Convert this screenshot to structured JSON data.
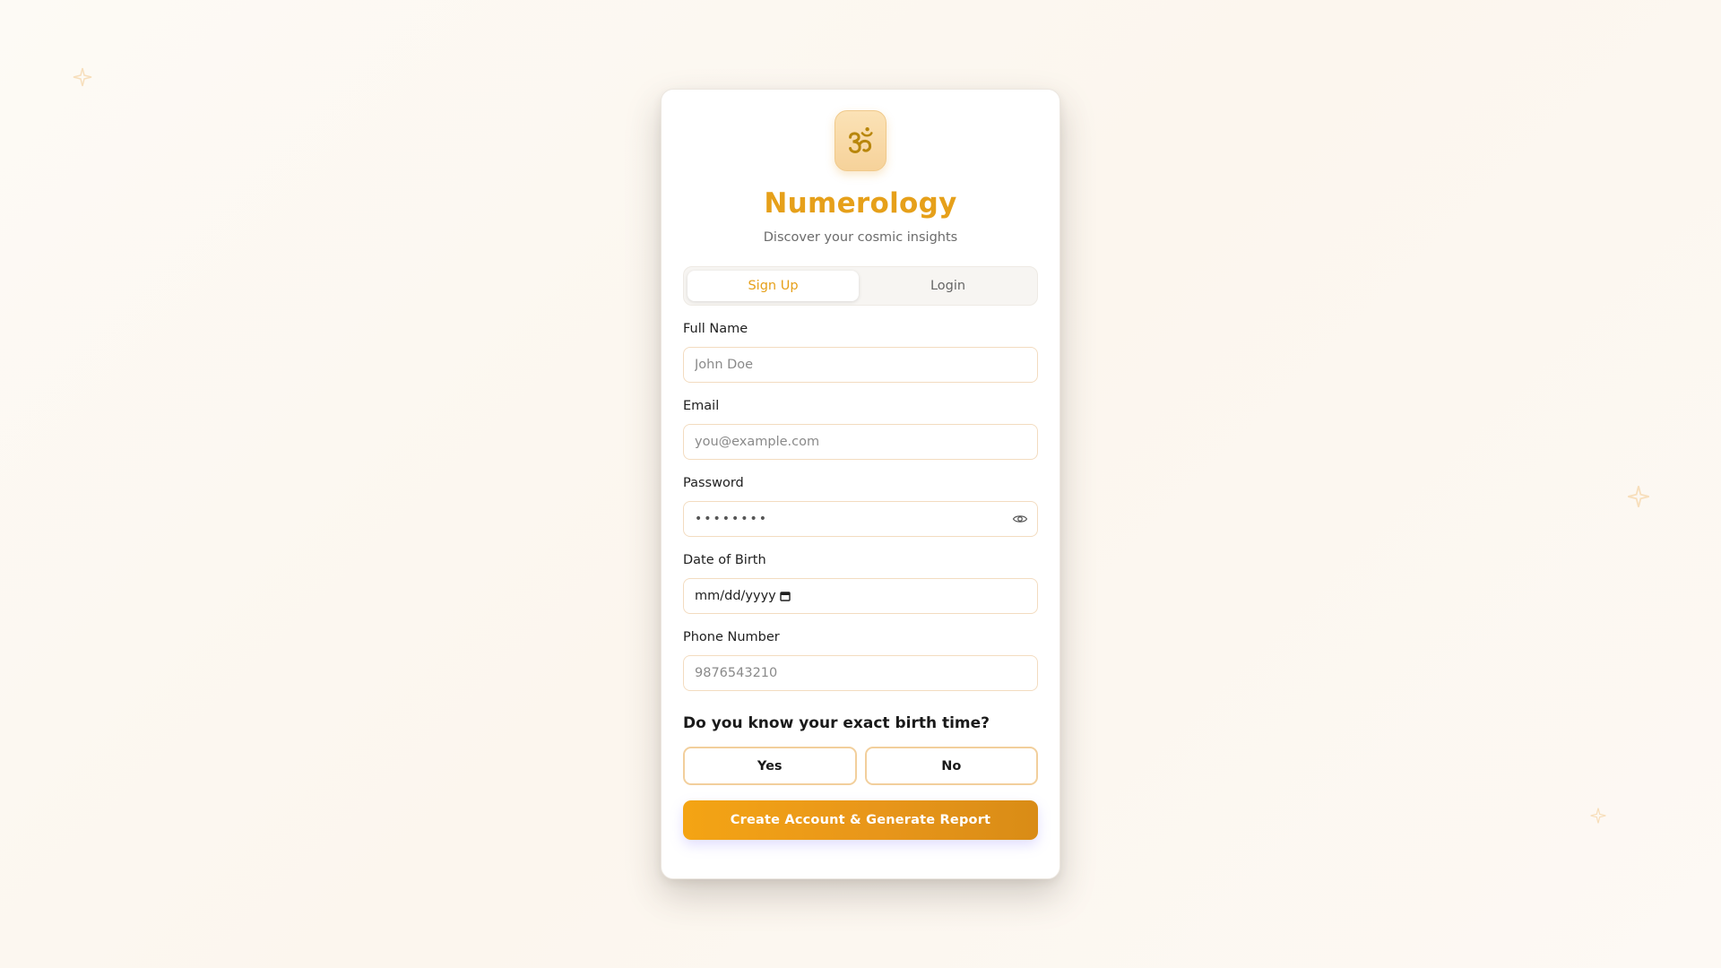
{
  "app": {
    "title": "Numerology",
    "subtitle": "Discover your cosmic insights",
    "logo_icon": "om-icon",
    "accent_color": "#e6a01a"
  },
  "tabs": [
    {
      "label": "Sign Up",
      "active": true
    },
    {
      "label": "Login",
      "active": false
    }
  ],
  "form": {
    "full_name": {
      "label": "Full Name",
      "placeholder": "John Doe",
      "value": ""
    },
    "email": {
      "label": "Email",
      "placeholder": "you@example.com",
      "value": ""
    },
    "password": {
      "label": "Password",
      "masked_value": "••••••••",
      "toggle_icon": "eye-icon"
    },
    "dob": {
      "label": "Date of Birth",
      "value": "mm/dd/yyyy",
      "icon": "calendar-icon"
    },
    "phone": {
      "label": "Phone Number",
      "placeholder": "9876543210",
      "value": ""
    }
  },
  "birth_time": {
    "question": "Do you know your exact birth time?",
    "yes_label": "Yes",
    "no_label": "No"
  },
  "submit_label": "Create Account & Generate Report"
}
